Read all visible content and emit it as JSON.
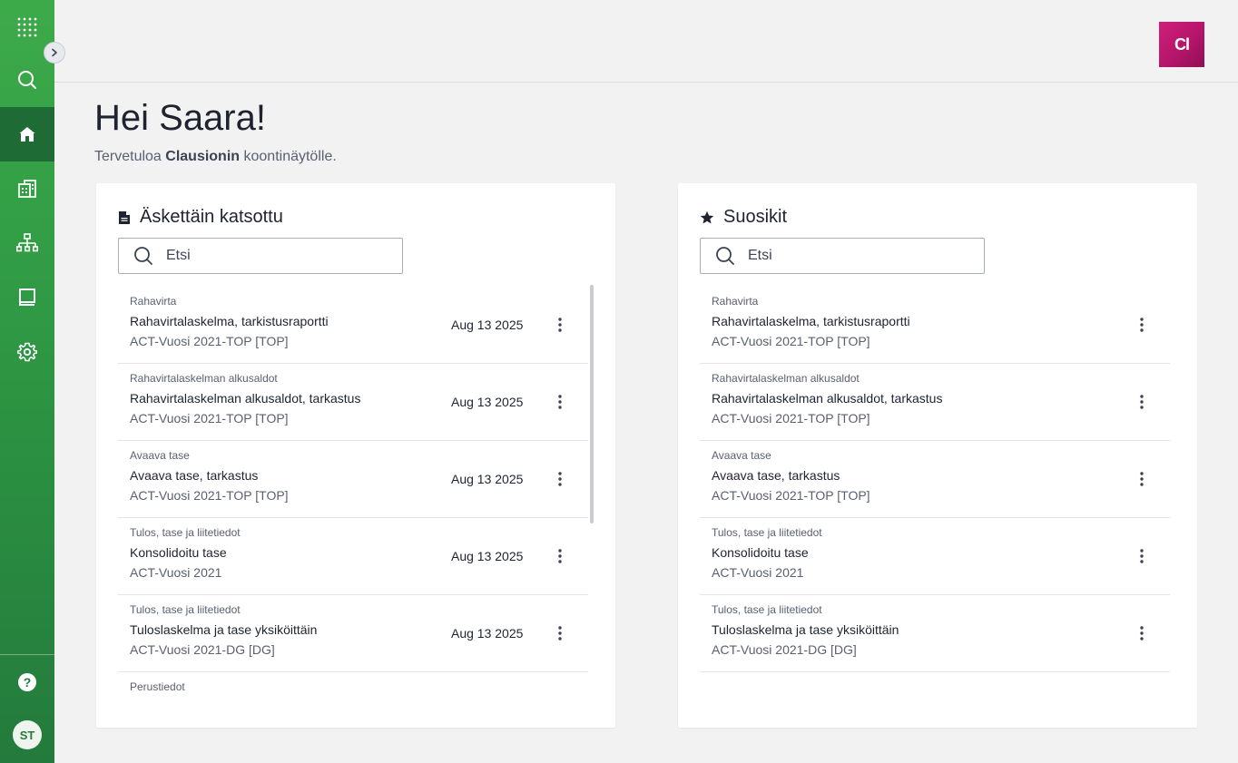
{
  "colors": {
    "sidebar_green": "#2f9a44",
    "active_green": "#1e6b35",
    "logo_magenta": "#c0186f",
    "background": "#f2f2f2"
  },
  "sidebar": {
    "items": [
      {
        "name": "apps-grid-icon"
      },
      {
        "name": "search-icon"
      },
      {
        "name": "home-icon",
        "active": true
      },
      {
        "name": "building-icon"
      },
      {
        "name": "hierarchy-icon"
      },
      {
        "name": "book-icon"
      },
      {
        "name": "gear-icon"
      }
    ],
    "help_icon": "help-icon",
    "avatar_initials": "ST"
  },
  "header": {
    "logo_text": "Cl"
  },
  "greeting": {
    "title": "Hei Saara!",
    "subtitle_prefix": "Tervetuloa ",
    "subtitle_bold": "Clausionin",
    "subtitle_suffix": " koontinäytölle."
  },
  "recent": {
    "title": "Äskettäin katsottu",
    "search_placeholder": "Etsi",
    "items": [
      {
        "category": "Rahavirta",
        "name": "Rahavirtalaskelma, tarkistusraportti",
        "entity": "ACT-Vuosi 2021-TOP [TOP]",
        "date": "Aug 13 2025"
      },
      {
        "category": "Rahavirtalaskelman alkusaldot",
        "name": "Rahavirtalaskelman alkusaldot, tarkastus",
        "entity": "ACT-Vuosi 2021-TOP [TOP]",
        "date": "Aug 13 2025"
      },
      {
        "category": "Avaava tase",
        "name": "Avaava tase, tarkastus",
        "entity": "ACT-Vuosi 2021-TOP [TOP]",
        "date": "Aug 13 2025"
      },
      {
        "category": "Tulos, tase ja liitetiedot",
        "name": "Konsolidoitu tase",
        "entity": "ACT-Vuosi 2021",
        "date": "Aug 13 2025"
      },
      {
        "category": "Tulos, tase ja liitetiedot",
        "name": "Tuloslaskelma ja tase yksiköittäin",
        "entity": "ACT-Vuosi 2021-DG [DG]",
        "date": "Aug 13 2025"
      },
      {
        "category": "Perustiedot",
        "name": "",
        "entity": "",
        "date": ""
      }
    ]
  },
  "favorites": {
    "title": "Suosikit",
    "search_placeholder": "Etsi",
    "items": [
      {
        "category": "Rahavirta",
        "name": "Rahavirtalaskelma, tarkistusraportti",
        "entity": "ACT-Vuosi 2021-TOP [TOP]"
      },
      {
        "category": "Rahavirtalaskelman alkusaldot",
        "name": "Rahavirtalaskelman alkusaldot, tarkastus",
        "entity": "ACT-Vuosi 2021-TOP [TOP]"
      },
      {
        "category": "Avaava tase",
        "name": "Avaava tase, tarkastus",
        "entity": "ACT-Vuosi 2021-TOP [TOP]"
      },
      {
        "category": "Tulos, tase ja liitetiedot",
        "name": "Konsolidoitu tase",
        "entity": "ACT-Vuosi 2021"
      },
      {
        "category": "Tulos, tase ja liitetiedot",
        "name": "Tuloslaskelma ja tase yksiköittäin",
        "entity": "ACT-Vuosi 2021-DG [DG]"
      }
    ]
  }
}
